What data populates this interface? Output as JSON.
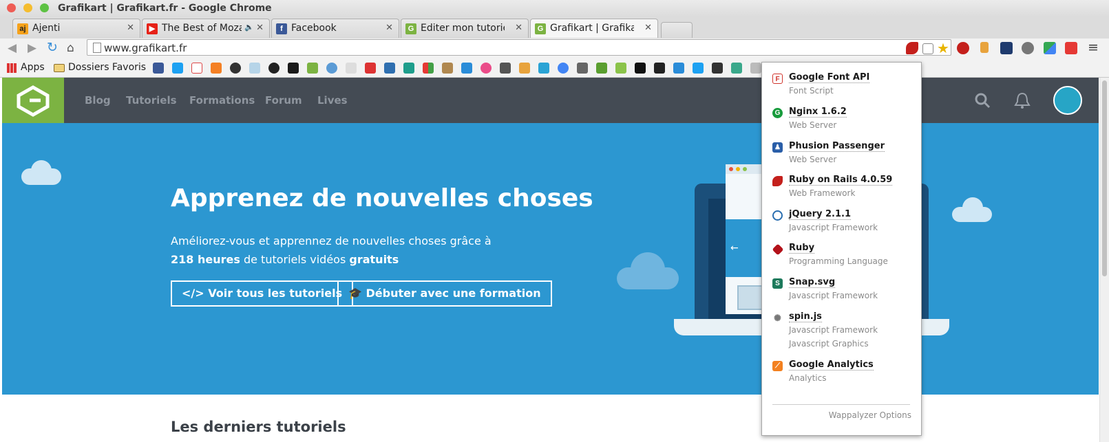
{
  "window": {
    "title": "Grafikart | Grafikart.fr - Google Chrome"
  },
  "tabs": [
    {
      "label": "Ajenti",
      "favicon": "ajenti-icon",
      "active": false
    },
    {
      "label": "The Best of Mozar",
      "favicon": "youtube-icon",
      "active": false,
      "audio": true
    },
    {
      "label": "Facebook",
      "favicon": "facebook-icon",
      "active": false
    },
    {
      "label": "Editer mon tutoriel |",
      "favicon": "grafikart-icon",
      "active": false
    },
    {
      "label": "Grafikart | Grafikart.",
      "favicon": "grafikart-icon",
      "active": true
    }
  ],
  "toolbar": {
    "url": "www.grafikart.fr"
  },
  "bookmarks": {
    "apps_label": "Apps",
    "folder_label": "Dossiers Favoris"
  },
  "site": {
    "nav": [
      "Blog",
      "Tutoriels",
      "Formations",
      "Forum",
      "Lives"
    ],
    "hero": {
      "title": "Apprenez de nouvelles choses",
      "line1": "Améliorez-vous et apprennez de nouvelles choses grâce à",
      "line2_bold1": "218 heures",
      "line2_mid": " de tutoriels vidéos ",
      "line2_bold2": "gratuits",
      "btn_tutorials": "Voir tous les tutoriels",
      "btn_formation": "Débuter avec une formation"
    },
    "latest_heading": "Les derniers tutoriels"
  },
  "wappalyzer": {
    "apps": [
      {
        "name": "Google Font API",
        "categories": [
          "Font Script"
        ],
        "icon": "google-font-api-icon",
        "color": "#d0342c"
      },
      {
        "name": "Nginx 1.6.2",
        "categories": [
          "Web Server"
        ],
        "icon": "nginx-icon",
        "color": "#179b3c"
      },
      {
        "name": "Phusion Passenger",
        "categories": [
          "Web Server"
        ],
        "icon": "phusion-passenger-icon",
        "color": "#2a5ea8"
      },
      {
        "name": "Ruby on Rails 4.0.59",
        "categories": [
          "Web Framework"
        ],
        "icon": "rails-icon",
        "color": "#c4201c"
      },
      {
        "name": "jQuery 2.1.1",
        "categories": [
          "Javascript Framework"
        ],
        "icon": "jquery-icon",
        "color": "#2a6eb0"
      },
      {
        "name": "Ruby",
        "categories": [
          "Programming Language"
        ],
        "icon": "ruby-icon",
        "color": "#b3121a"
      },
      {
        "name": "Snap.svg",
        "categories": [
          "Javascript Framework"
        ],
        "icon": "snap-svg-icon",
        "color": "#1d7a5c"
      },
      {
        "name": "spin.js",
        "categories": [
          "Javascript Framework",
          "Javascript Graphics"
        ],
        "icon": "spin-js-icon",
        "color": "#888888"
      },
      {
        "name": "Google Analytics",
        "categories": [
          "Analytics"
        ],
        "icon": "google-analytics-icon",
        "color": "#f3801f"
      }
    ],
    "options_label": "Wappalyzer Options"
  }
}
